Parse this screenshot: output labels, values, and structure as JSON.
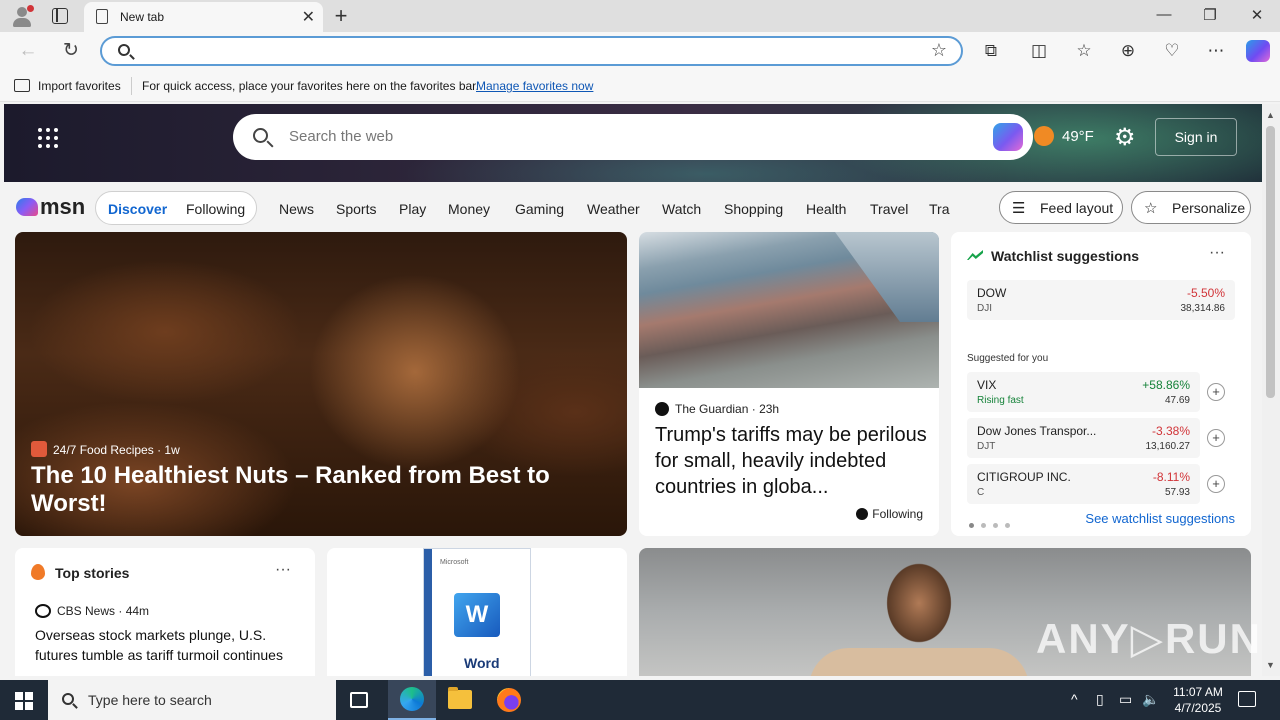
{
  "browser": {
    "tab_title": "New tab",
    "new_tab_glyph": "+",
    "close_tab_glyph": "✕",
    "window_controls": {
      "minimize": "—",
      "restore": "❐",
      "close": "✕"
    },
    "address_value": "",
    "favorites_bar": {
      "import_label": "Import favorites",
      "message": "For quick access, place your favorites here on the favorites bar.",
      "manage_link": "Manage favorites now"
    }
  },
  "msn": {
    "search_placeholder": "Search the web",
    "temperature": "49°F",
    "sign_in": "Sign in",
    "logo": "msn",
    "pill": {
      "discover": "Discover",
      "following": "Following"
    },
    "nav_items": [
      "News",
      "Sports",
      "Play",
      "Money",
      "Gaming",
      "Weather",
      "Watch",
      "Shopping",
      "Health",
      "Travel",
      "Tra"
    ],
    "feed_layout": "Feed layout",
    "personalize": "Personalize",
    "hero": {
      "source": "24/7 Food Recipes",
      "age": "1w",
      "headline": "The 10 Healthiest Nuts – Ranked from Best to Worst!"
    },
    "guardian": {
      "source": "The Guardian",
      "age": "23h",
      "headline": "Trump's tariffs may be perilous for small, heavily indebted countries in globa...",
      "following": "Following"
    },
    "watchlist": {
      "title": "Watchlist suggestions",
      "more": "···",
      "suggested_label": "Suggested for you",
      "see_all": "See watchlist suggestions",
      "main": {
        "name": "DOW",
        "ticker": "DJI",
        "change": "-5.50%",
        "price": "38,314.86",
        "color": "#d13438"
      },
      "suggestions": [
        {
          "name": "VIX",
          "ticker": "Rising fast",
          "change": "+58.86%",
          "price": "47.69",
          "color": "#16833a"
        },
        {
          "name": "Dow Jones Transpor...",
          "ticker": "DJT",
          "change": "-3.38%",
          "price": "13,160.27",
          "color": "#d13438"
        },
        {
          "name": "CITIGROUP INC.",
          "ticker": "C",
          "change": "-8.11%",
          "price": "57.93",
          "color": "#d13438"
        }
      ],
      "add_glyph": "+"
    },
    "top_stories": {
      "title": "Top stories",
      "more": "···",
      "source": "CBS News",
      "age": "44m",
      "headline": "Overseas stock markets plunge, U.S. futures tumble as tariff turmoil continues"
    },
    "word_ad": {
      "brand": "Microsoft",
      "word": "Word",
      "letter": "W"
    }
  },
  "watermark": "ANY▷RUN",
  "taskbar": {
    "search_placeholder": "Type here to search",
    "time": "11:07 AM",
    "date": "4/7/2025"
  }
}
